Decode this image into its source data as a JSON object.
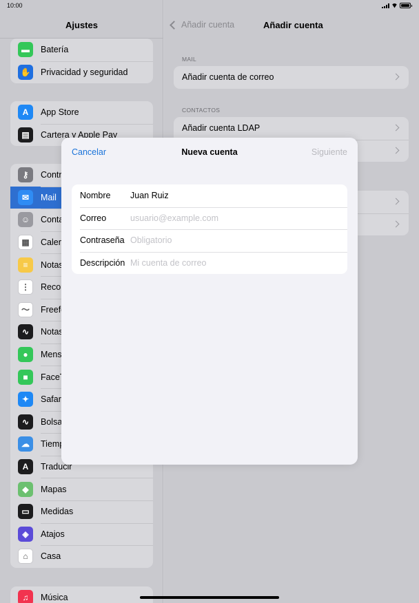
{
  "status": {
    "time": "10:00"
  },
  "sidebar": {
    "title": "Ajustes",
    "groups": [
      {
        "items": [
          {
            "label": "Batería",
            "icon": "battery-icon",
            "color": "#34c759",
            "glyph": "▬"
          },
          {
            "label": "Privacidad y seguridad",
            "icon": "hand-icon",
            "color": "#1f6fe0",
            "glyph": "✋"
          }
        ]
      },
      {
        "items": [
          {
            "label": "App Store",
            "icon": "app-store-icon",
            "color": "#1e88f5",
            "glyph": "A"
          },
          {
            "label": "Cartera y Apple Pay",
            "icon": "wallet-icon",
            "color": "#1c1c1e",
            "glyph": "▤"
          }
        ]
      },
      {
        "items": [
          {
            "label": "Contraseñas",
            "icon": "key-icon",
            "color": "#7a7a80",
            "glyph": "⚷"
          },
          {
            "label": "Mail",
            "icon": "mail-icon",
            "color": "#2f8cf4",
            "glyph": "✉",
            "selected": true
          },
          {
            "label": "Contactos",
            "icon": "contacts-icon",
            "color": "#9a9aa0",
            "glyph": "☺"
          },
          {
            "label": "Calendario",
            "icon": "calendar-icon",
            "color": "#ffffff",
            "glyph": "▦"
          },
          {
            "label": "Notas",
            "icon": "notes-icon",
            "color": "#f7c948",
            "glyph": "≡"
          },
          {
            "label": "Recordatorios",
            "icon": "reminders-icon",
            "color": "#ffffff",
            "glyph": "⋮"
          },
          {
            "label": "Freeform",
            "icon": "freeform-icon",
            "color": "#ffffff",
            "glyph": "〜"
          },
          {
            "label": "Notas de voz",
            "icon": "voice-memos-icon",
            "color": "#1c1c1e",
            "glyph": "∿"
          },
          {
            "label": "Mensajes",
            "icon": "messages-icon",
            "color": "#34c759",
            "glyph": "●"
          },
          {
            "label": "FaceTime",
            "icon": "facetime-icon",
            "color": "#34c759",
            "glyph": "■"
          },
          {
            "label": "Safari",
            "icon": "safari-icon",
            "color": "#1e88f5",
            "glyph": "✦"
          },
          {
            "label": "Bolsa",
            "icon": "stocks-icon",
            "color": "#1c1c1e",
            "glyph": "∿"
          },
          {
            "label": "Tiempo",
            "icon": "weather-icon",
            "color": "#3b8fe6",
            "glyph": "☁"
          },
          {
            "label": "Traducir",
            "icon": "translate-icon",
            "color": "#1c1c1e",
            "glyph": "A"
          },
          {
            "label": "Mapas",
            "icon": "maps-icon",
            "color": "#6cc070",
            "glyph": "◆"
          },
          {
            "label": "Medidas",
            "icon": "measure-icon",
            "color": "#1c1c1e",
            "glyph": "▭"
          },
          {
            "label": "Atajos",
            "icon": "shortcuts-icon",
            "color": "#5b4bd8",
            "glyph": "◈"
          },
          {
            "label": "Casa",
            "icon": "home-icon",
            "color": "#ffffff",
            "glyph": "⌂"
          }
        ]
      },
      {
        "items": [
          {
            "label": "Música",
            "icon": "music-icon",
            "color": "#f2334f",
            "glyph": "♫"
          }
        ]
      }
    ]
  },
  "main": {
    "back_label": "Añadir cuenta",
    "title": "Añadir cuenta",
    "sections": [
      {
        "label": "MAIL",
        "rows": [
          "Añadir cuenta de correo"
        ]
      },
      {
        "label": "CONTACTOS",
        "rows": [
          "Añadir cuenta LDAP",
          ""
        ]
      },
      {
        "label": "",
        "rows": [
          "",
          ""
        ]
      }
    ]
  },
  "modal": {
    "cancel_label": "Cancelar",
    "title": "Nueva cuenta",
    "next_label": "Siguiente",
    "fields": [
      {
        "label": "Nombre",
        "value": "Juan Ruiz",
        "placeholder": ""
      },
      {
        "label": "Correo",
        "value": "",
        "placeholder": "usuario@example.com"
      },
      {
        "label": "Contraseña",
        "value": "",
        "placeholder": "Obligatorio"
      },
      {
        "label": "Descripción",
        "value": "",
        "placeholder": "Mi cuenta de correo"
      }
    ]
  }
}
